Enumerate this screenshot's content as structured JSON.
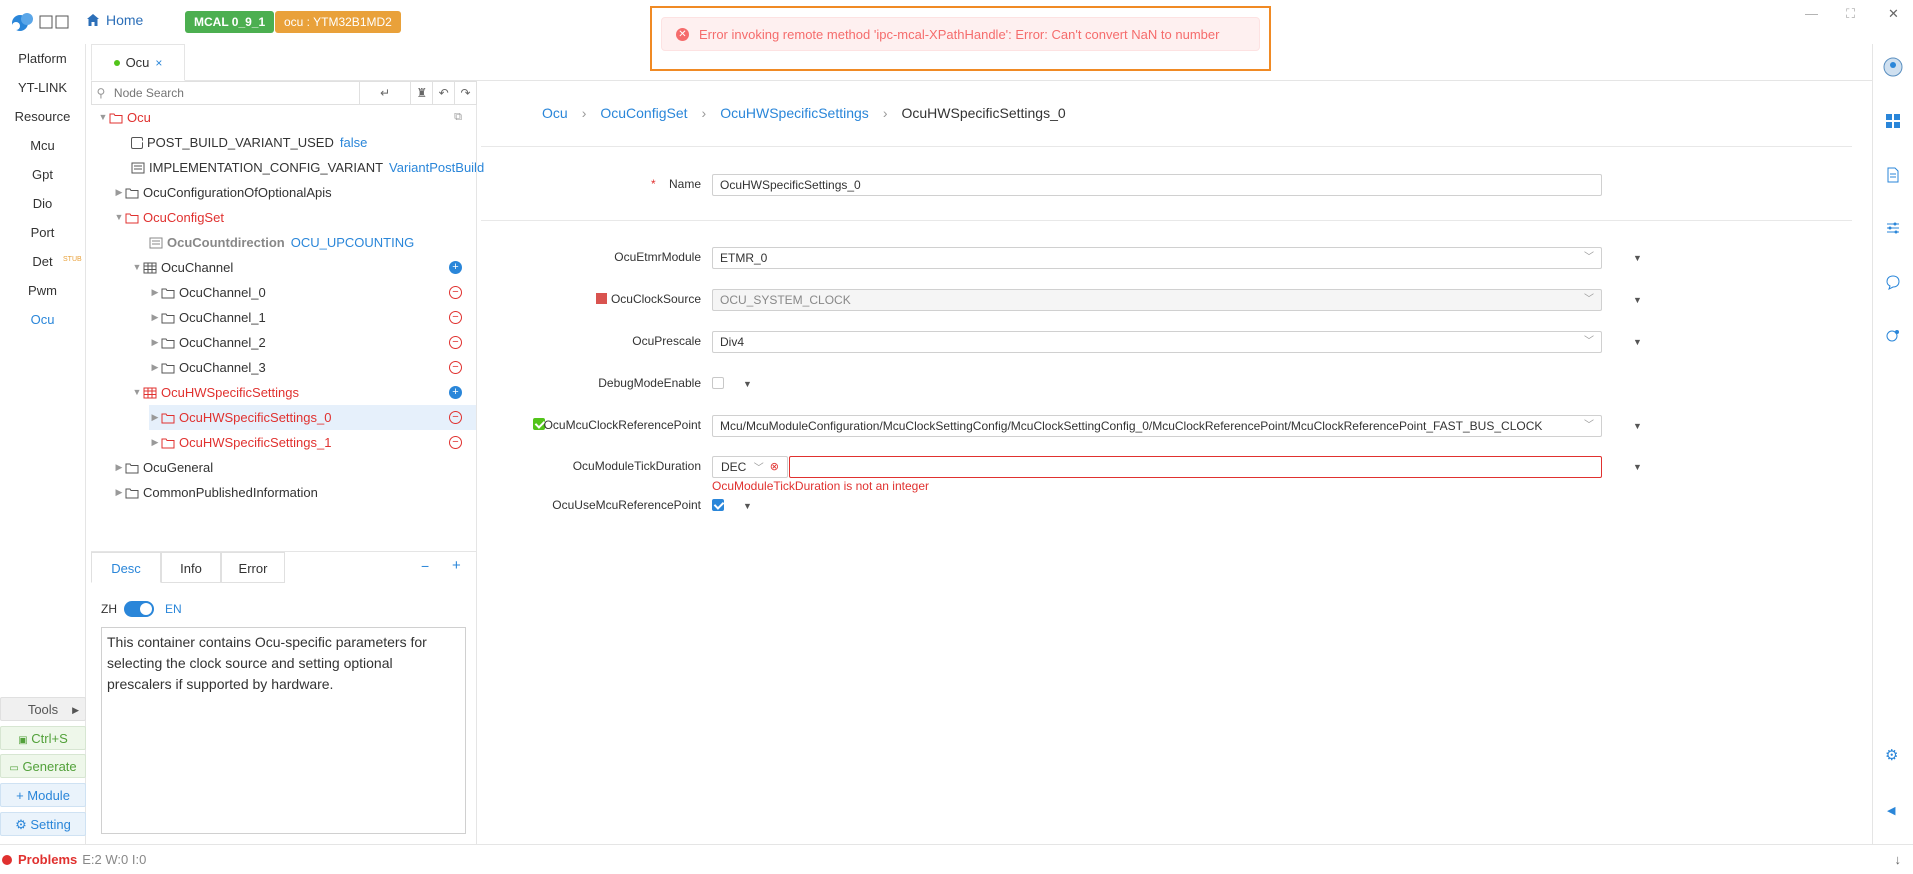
{
  "topbar": {
    "home_label": "Home",
    "version_tag": "MCAL 0_9_1",
    "chip_tag": "ocu : YTM32B1MD2",
    "minimize": "—",
    "restore": "⛶",
    "close": "✕"
  },
  "leftnav": {
    "items": [
      "Platform",
      "YT-LINK",
      "Resource",
      "Mcu",
      "Gpt",
      "Dio",
      "Port",
      "Det",
      "Pwm",
      "Ocu"
    ],
    "det_badge": "STUB",
    "tools_label": "Tools",
    "save_label": "Ctrl+S",
    "generate_label": "Generate",
    "module_label": "Module",
    "setting_label": "Setting"
  },
  "tab": {
    "label": "Ocu",
    "close": "×"
  },
  "tree": {
    "search_placeholder": "Node Search",
    "nodes": {
      "root": "Ocu",
      "post_build": "POST_BUILD_VARIANT_USED",
      "post_build_val": "false",
      "impl_cfg": "IMPLEMENTATION_CONFIG_VARIANT",
      "impl_cfg_val": "VariantPostBuild",
      "optional_apis": "OcuConfigurationOfOptionalApis",
      "config_set": "OcuConfigSet",
      "countdirection": "OcuCountdirection",
      "countdirection_val": "OCU_UPCOUNTING",
      "channel": "OcuChannel",
      "ch0": "OcuChannel_0",
      "ch1": "OcuChannel_1",
      "ch2": "OcuChannel_2",
      "ch3": "OcuChannel_3",
      "hw": "OcuHWSpecificSettings",
      "hw0": "OcuHWSpecificSettings_0",
      "hw1": "OcuHWSpecificSettings_1",
      "general": "OcuGeneral",
      "common": "CommonPublishedInformation"
    }
  },
  "desc": {
    "tabs": [
      "Desc",
      "Info",
      "Error"
    ],
    "minus": "−",
    "plus": "+",
    "lang_zh": "ZH",
    "lang_en": "EN",
    "text": "This container contains Ocu-specific parameters for selecting the clock source and setting optional prescalers if supported by hardware."
  },
  "breadcrumb": [
    "Ocu",
    "OcuConfigSet",
    "OcuHWSpecificSettings",
    "OcuHWSpecificSettings_0"
  ],
  "form": {
    "name_label": "Name",
    "name_required": "*",
    "name_value": "OcuHWSpecificSettings_0",
    "etmr_label": "OcuEtmrModule",
    "etmr_value": "ETMR_0",
    "clock_label": "OcuClockSource",
    "clock_value": "OCU_SYSTEM_CLOCK",
    "prescale_label": "OcuPrescale",
    "prescale_value": "Div4",
    "debug_label": "DebugModeEnable",
    "mcuref_label": "OcuMcuClockReferencePoint",
    "mcuref_value": "Mcu/McuModuleConfiguration/McuClockSettingConfig/McuClockSettingConfig_0/McuClockReferencePoint/McuClockReferencePoint_FAST_BUS_CLOCK",
    "tick_label": "OcuModuleTickDuration",
    "tick_format": "DEC",
    "tick_error": "OcuModuleTickDuration is not an integer",
    "usemcu_label": "OcuUseMcuReferencePoint"
  },
  "toast": {
    "message": "Error invoking remote method 'ipc-mcal-XPathHandle': Error: Can't convert NaN to number"
  },
  "status": {
    "problems_label": "Problems",
    "counts": "E:2 W:0 I:0"
  },
  "colors": {
    "accent": "#2a86d9",
    "error": "#e0312f",
    "green": "#4caf50",
    "orange": "#e9a13a"
  }
}
